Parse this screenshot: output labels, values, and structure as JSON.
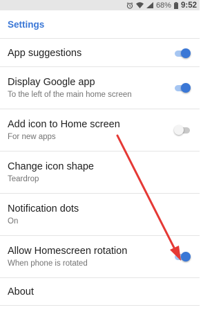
{
  "status_bar": {
    "icons": [
      "alarm-icon",
      "wifi-icon",
      "signal-icon"
    ],
    "battery_percent": "68%",
    "time": "9:52"
  },
  "app_bar": {
    "title": "Settings"
  },
  "settings": [
    {
      "title": "App suggestions",
      "subtitle": "",
      "toggle": "on"
    },
    {
      "title": "Display Google app",
      "subtitle": "To the left of the main home screen",
      "toggle": "on"
    },
    {
      "title": "Add icon to Home screen",
      "subtitle": "For new apps",
      "toggle": "off"
    },
    {
      "title": "Change icon shape",
      "subtitle": "Teardrop",
      "toggle": null
    },
    {
      "title": "Notification dots",
      "subtitle": "On",
      "toggle": null
    },
    {
      "title": "Allow Homescreen rotation",
      "subtitle": "When phone is rotated",
      "toggle": "on"
    },
    {
      "title": "About",
      "subtitle": "",
      "toggle": null
    }
  ],
  "colors": {
    "accent": "#3a77d6",
    "toggle_track_on": "#a6c6f2",
    "toggle_off_thumb": "#f4f4f4",
    "annotation_arrow": "#e53935"
  }
}
